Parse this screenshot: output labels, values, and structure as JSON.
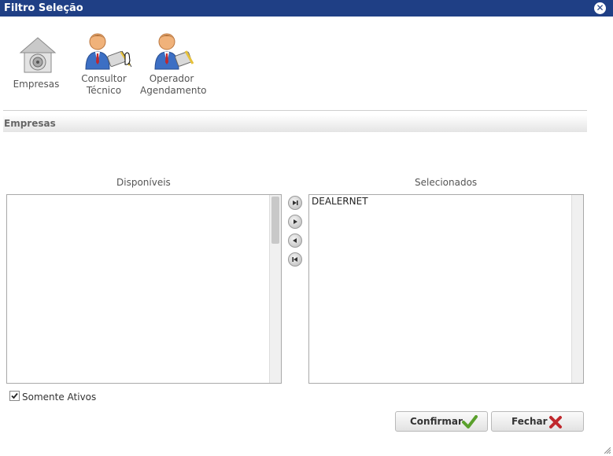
{
  "window": {
    "title": "Filtro Seleção",
    "close_icon": "close-circle-icon"
  },
  "toolbar": {
    "empresas_label": "Empresas",
    "consultor_line1": "Consultor",
    "consultor_line2": "Técnico",
    "operador_line1": "Operador",
    "operador_line2": "Agendamento"
  },
  "section": {
    "title": "Empresas"
  },
  "available": {
    "title": "Disponíveis",
    "items": []
  },
  "selected": {
    "title": "Selecionados",
    "items": [
      "DEALERNET"
    ]
  },
  "arrows": [
    "move-all-right-icon",
    "move-right-icon",
    "move-left-icon",
    "move-all-left-icon"
  ],
  "filter": {
    "label": "Somente Ativos",
    "checked": true
  },
  "buttons": {
    "confirm": "Confirmar",
    "close": "Fechar"
  },
  "colors": {
    "titlebar": "#1f3f85",
    "confirm_check": "#5aa02c",
    "close_x": "#c0282d"
  }
}
